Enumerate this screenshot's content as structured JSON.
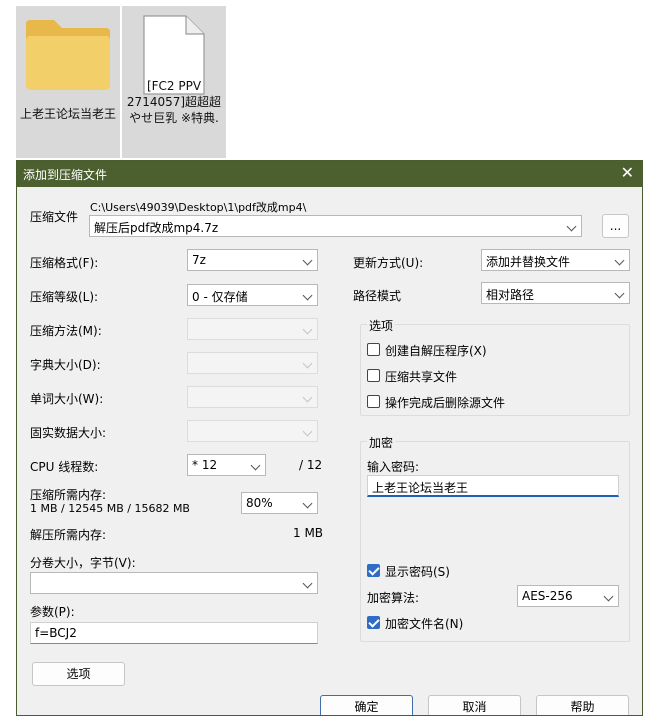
{
  "desktop": {
    "icons": [
      {
        "label": "上老王论坛当老王"
      },
      {
        "label": "[FC2 PPV 2714057]超超超やせ巨乳 ※特典."
      }
    ]
  },
  "dialog": {
    "title": "添加到压缩文件",
    "archive": {
      "label": "压缩文件",
      "path": "C:\\Users\\49039\\Desktop\\1\\pdf改成mp4\\",
      "value": "解压后pdf改成mp4.7z",
      "browse_label": "..."
    },
    "left": {
      "format": {
        "label": "压缩格式(F):",
        "value": "7z"
      },
      "level": {
        "label": "压缩等级(L):",
        "value": "0 - 仅存储"
      },
      "method": {
        "label": "压缩方法(M):"
      },
      "dict": {
        "label": "字典大小(D):"
      },
      "word": {
        "label": "单词大小(W):"
      },
      "solid": {
        "label": "固实数据大小:"
      },
      "threads": {
        "label": "CPU 线程数:",
        "value": "* 12",
        "max": "/ 12"
      },
      "mem_compress": {
        "label": "压缩所需内存:",
        "detail": "1 MB / 12545 MB / 15682 MB",
        "value": "80%"
      },
      "mem_decompress": {
        "label": "解压所需内存:",
        "value": "1 MB"
      },
      "split": {
        "label": "分卷大小，字节(V):",
        "value": ""
      },
      "params": {
        "label": "参数(P):",
        "value": "f=BCJ2"
      },
      "options_button": "选项"
    },
    "right": {
      "update": {
        "label": "更新方式(U):",
        "value": "添加并替换文件"
      },
      "pathmode": {
        "label": "路径模式",
        "value": "相对路径"
      },
      "options": {
        "title": "选项",
        "sfx": "创建自解压程序(X)",
        "shared": "压缩共享文件",
        "delete": "操作完成后删除源文件"
      },
      "encryption": {
        "title": "加密",
        "pw_label": "输入密码:",
        "pw_value": "上老王论坛当老王",
        "show_pw": "显示密码(S)",
        "method_label": "加密算法:",
        "method_value": "AES-256",
        "encrypt_names": "加密文件名(N)"
      }
    },
    "buttons": {
      "ok": "确定",
      "cancel": "取消",
      "help": "帮助"
    }
  },
  "colors": {
    "titlebar": "#4b5f2f",
    "accent": "#2f6cc4",
    "folder": "#f3cf6a"
  }
}
